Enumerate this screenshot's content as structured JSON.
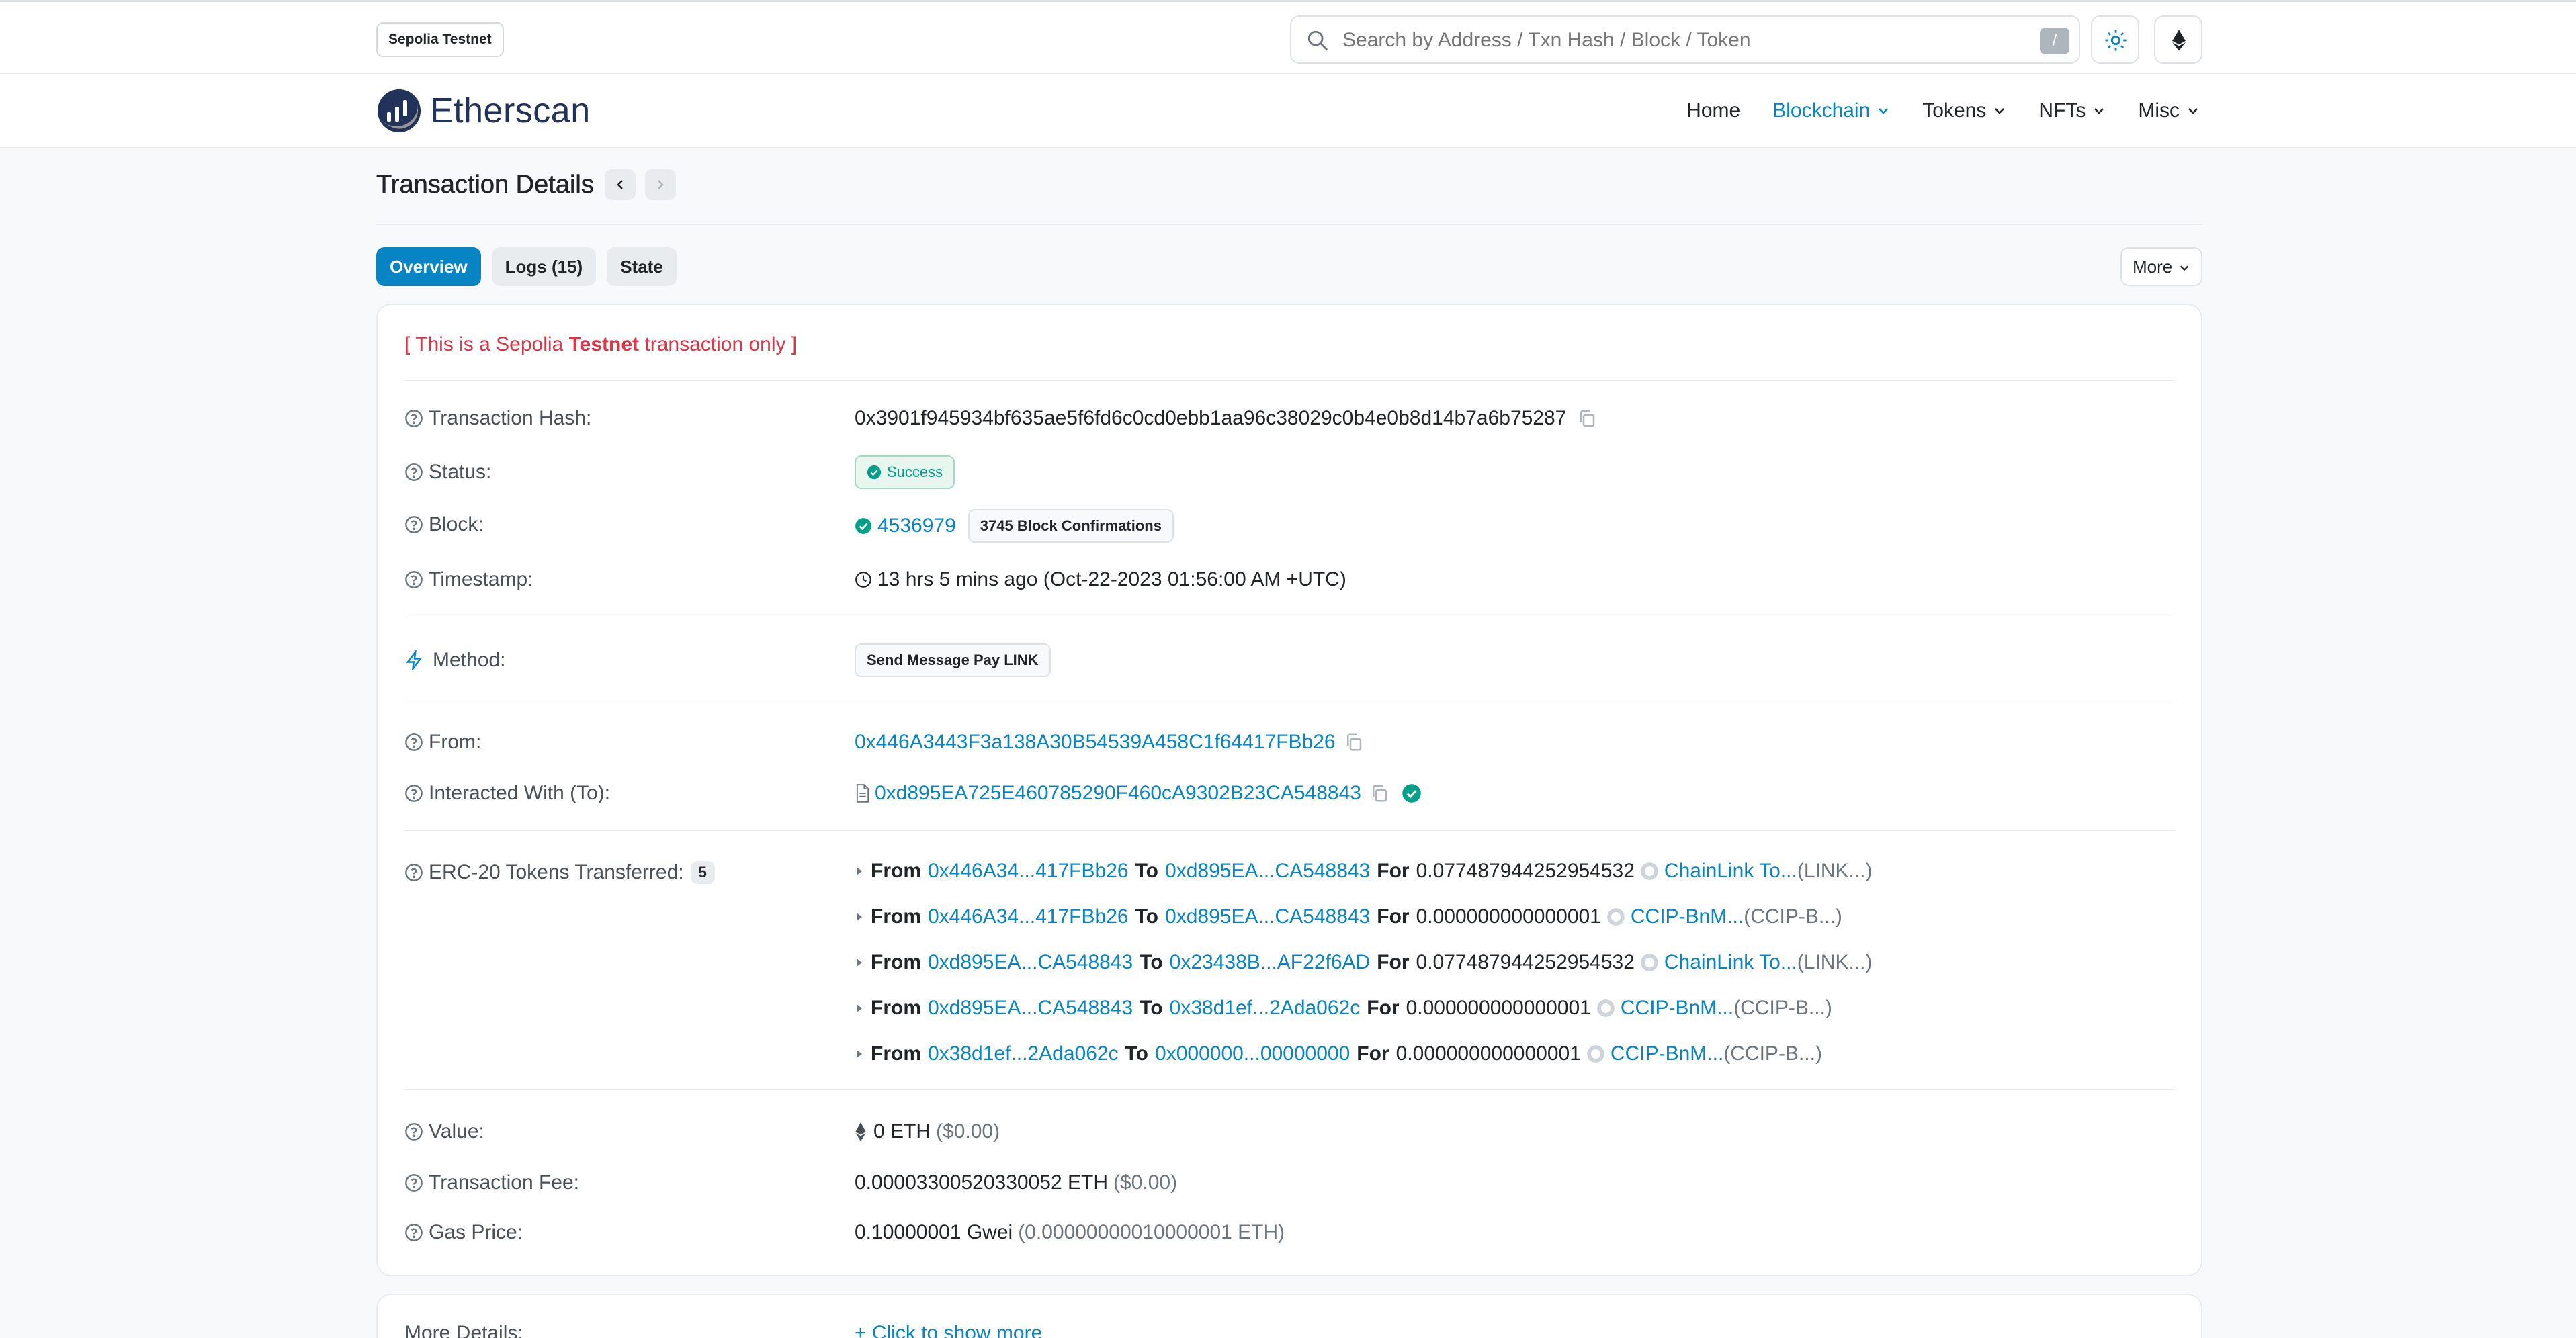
{
  "topbar": {
    "network_badge": "Sepolia Testnet",
    "search_placeholder": "Search by Address / Txn Hash / Block / Token",
    "search_shortcut": "/"
  },
  "nav": {
    "logo_text": "Etherscan",
    "items": [
      {
        "label": "Home"
      },
      {
        "label": "Blockchain"
      },
      {
        "label": "Tokens"
      },
      {
        "label": "NFTs"
      },
      {
        "label": "Misc"
      }
    ]
  },
  "page": {
    "title": "Transaction Details",
    "tabs": [
      "Overview",
      "Logs (15)",
      "State"
    ],
    "more_label": "More"
  },
  "notice": {
    "prefix": "[ This is a Sepolia ",
    "bold": "Testnet",
    "suffix": " transaction only ]"
  },
  "details": {
    "tx_hash_label": "Transaction Hash:",
    "tx_hash": "0x3901f945934bf635ae5f6fd6c0cd0ebb1aa96c38029c0b4e0b8d14b7a6b75287",
    "status_label": "Status:",
    "status": "Success",
    "block_label": "Block:",
    "block": "4536979",
    "confirmations": "3745 Block Confirmations",
    "timestamp_label": "Timestamp:",
    "timestamp": "13 hrs 5 mins ago (Oct-22-2023 01:56:00 AM +UTC)",
    "method_label": "Method:",
    "method": "Send Message Pay LINK",
    "from_label": "From:",
    "from": "0x446A3443F3a138A30B54539A458C1f64417FBb26",
    "to_label": "Interacted With (To):",
    "to": "0xd895EA725E460785290F460cA9302B23CA548843",
    "erc20_label": "ERC-20 Tokens Transferred:",
    "erc20_count": "5",
    "value_label": "Value:",
    "value": "0 ETH",
    "value_usd": "($0.00)",
    "fee_label": "Transaction Fee:",
    "fee": "0.00003300520330052 ETH",
    "fee_usd": "($0.00)",
    "gas_label": "Gas Price:",
    "gas": "0.10000001 Gwei",
    "gas_eth": "(0.00000000010000001 ETH)",
    "more_label": "More Details:",
    "more_link": "+ Click to show more"
  },
  "transfers": {
    "word_from": "From",
    "word_to": "To",
    "word_for": "For",
    "items": [
      {
        "from": "0x446A34...417FBb26",
        "to": "0xd895EA...CA548843",
        "amount": "0.077487944252954532",
        "token": "ChainLink To...",
        "symbol": "(LINK...)"
      },
      {
        "from": "0x446A34...417FBb26",
        "to": "0xd895EA...CA548843",
        "amount": "0.000000000000001",
        "token": "CCIP-BnM...",
        "symbol": "(CCIP-B...)"
      },
      {
        "from": "0xd895EA...CA548843",
        "to": "0x23438B...AF22f6AD",
        "amount": "0.077487944252954532",
        "token": "ChainLink To...",
        "symbol": "(LINK...)"
      },
      {
        "from": "0xd895EA...CA548843",
        "to": "0x38d1ef...2Ada062c",
        "amount": "0.000000000000001",
        "token": "CCIP-BnM...",
        "symbol": "(CCIP-B...)"
      },
      {
        "from": "0x38d1ef...2Ada062c",
        "to": "0x000000...00000000",
        "amount": "0.000000000000001",
        "token": "CCIP-BnM...",
        "symbol": "(CCIP-B...)"
      }
    ]
  },
  "colors": {
    "accent": "#0784c3",
    "success": "#00a186",
    "danger": "#dc3545"
  }
}
